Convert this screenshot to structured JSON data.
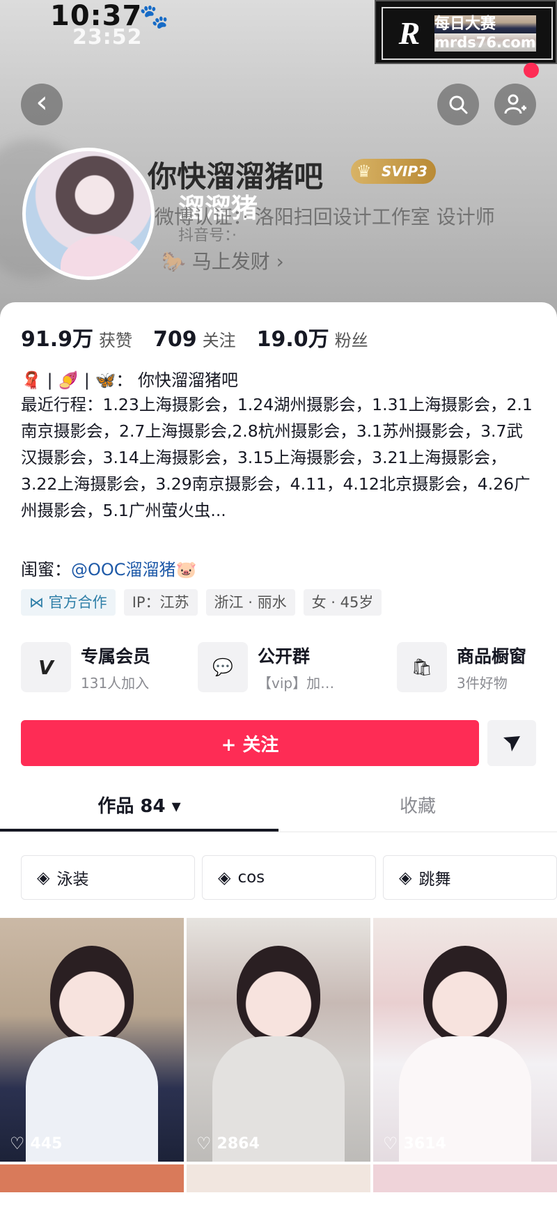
{
  "status_bar": {
    "time": "10:37",
    "paw_icon": "🐾",
    "sub_time": "23:52"
  },
  "watermark": {
    "logo": "R",
    "line1": "每日大赛",
    "line2": "mrds76.com"
  },
  "header": {
    "back_icon": "‹",
    "search_icon": "⌕",
    "add_friend_icon": "👤"
  },
  "profile": {
    "nickname": "你快溜溜猪吧",
    "vip_badge": "SVIP3",
    "vip_crown": "♛",
    "overlay_name": "溜溜猪",
    "certification": "微博认证：· 洛阳扫回设计工作室 设计师",
    "douyin_id": "抖音号：·",
    "fortune": "马上发财 ›",
    "fortune_icon": "🐎"
  },
  "stats": [
    {
      "num": "91.9万",
      "label": "获赞"
    },
    {
      "num": "709",
      "label": "关注"
    },
    {
      "num": "19.0万",
      "label": "粉丝"
    }
  ],
  "bio": {
    "line1": "🧣 | 🍠 | 🦋：  你快溜溜猪吧",
    "schedule": "最近行程：1.23上海摄影会，1.24湖州摄影会，1.31上海摄影会，2.1南京摄影会，2.7上海摄影会,2.8杭州摄影会，3.1苏州摄影会，3.7武汉摄影会，3.14上海摄影会，3.15上海摄影会，3.21上海摄影会，3.22上海摄影会，3.29南京摄影会，4.11，4.12北京摄影会，4.26广州摄影会，5.1广州萤火虫...",
    "bestie_label": "闺蜜：",
    "bestie_link": "@OOC溜溜猪🐷"
  },
  "tags": [
    "⋈ 官方合作",
    "IP：江苏",
    "浙江 · 丽水",
    "女 · 45岁"
  ],
  "services": [
    {
      "icon": "V",
      "title": "专属会员",
      "sub": "131人加入"
    },
    {
      "icon": "💬",
      "title": "公开群",
      "sub": "【vip】加…"
    },
    {
      "icon": "🛍",
      "title": "商品橱窗",
      "sub": "3件好物"
    }
  ],
  "actions": {
    "follow": "+ 关注",
    "share_icon": "▼"
  },
  "tabs": {
    "works": "作品 84 ▾",
    "favorites": "收藏"
  },
  "collections": [
    {
      "icon": "◈",
      "label": "泳装"
    },
    {
      "icon": "◈",
      "label": "cos"
    },
    {
      "icon": "◈",
      "label": "跳舞"
    }
  ],
  "videos": [
    {
      "likes": "445"
    },
    {
      "likes": "2864"
    },
    {
      "likes": "3614"
    }
  ],
  "colors": {
    "accent": "#fe2c55",
    "link": "#1f5aa8",
    "official_tag": "#2f7fa8"
  }
}
